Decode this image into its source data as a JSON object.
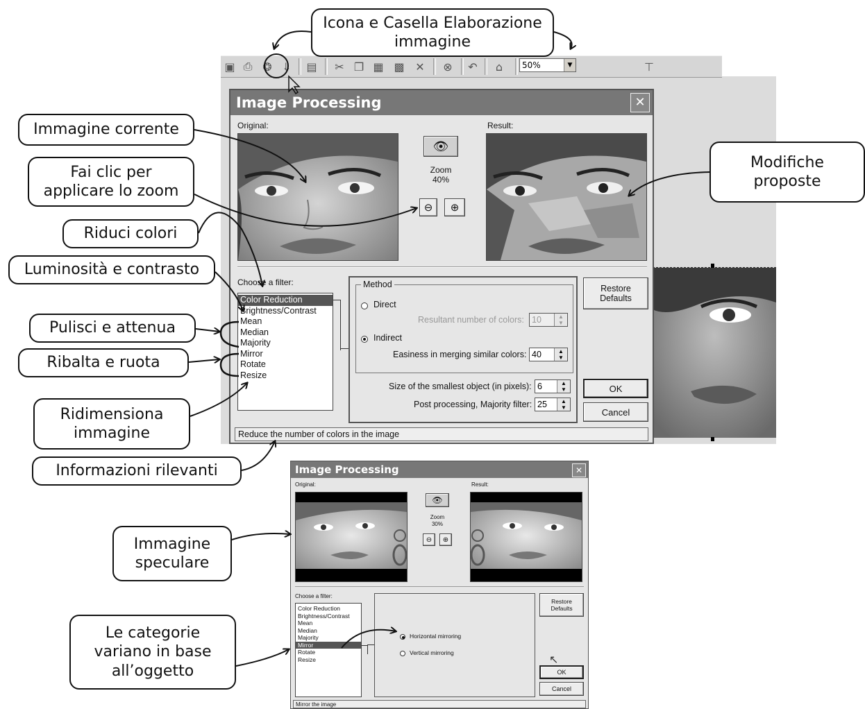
{
  "callouts": {
    "icona": [
      "Icona e Casella Elaborazione",
      "immagine"
    ],
    "immagine_corrente": "Immagine corrente",
    "fai_clic": [
      "Fai clic per",
      "applicare lo zoom"
    ],
    "modifiche": [
      "Modifiche",
      "proposte"
    ],
    "riduci": "Riduci colori",
    "luminosita": "Luminosità e contrasto",
    "pulisci": "Pulisci e attenua",
    "ribalta": "Ribalta e ruota",
    "ridimensiona": [
      "Ridimensiona",
      "immagine"
    ],
    "informazioni": "Informazioni rilevanti",
    "speculare": [
      "Immagine",
      "speculare"
    ],
    "categorie": [
      "Le categorie",
      "variano in base",
      "all’oggetto"
    ]
  },
  "toolbar": {
    "zoom_value": "50%"
  },
  "dialog_main": {
    "title": "Image Processing",
    "close": "✕",
    "original_label": "Original:",
    "result_label": "Result:",
    "zoom_label": "Zoom",
    "zoom_value": "40%",
    "filter_label": "Choose a filter:",
    "filters": [
      "Color Reduction",
      "Brightness/Contrast",
      "Mean",
      "Median",
      "Majority",
      "Mirror",
      "Rotate",
      "Resize"
    ],
    "selected_filter": "Color Reduction",
    "method_label": "Method",
    "direct_label": "Direct",
    "resultant_label": "Resultant number of colors:",
    "resultant_value": "10",
    "indirect_label": "Indirect",
    "easiness_label": "Easiness in merging similar colors:",
    "easiness_value": "40",
    "smallest_label": "Size of the smallest object (in pixels):",
    "smallest_value": "6",
    "post_label": "Post processing, Majority filter:",
    "post_value": "25",
    "restore_line1": "Restore",
    "restore_line2": "Defaults",
    "ok": "OK",
    "cancel": "Cancel",
    "status": "Reduce the number of colors in the image"
  },
  "dialog_small": {
    "title": "Image Processing",
    "close": "✕",
    "original_label": "Original:",
    "result_label": "Result:",
    "zoom_label": "Zoom",
    "zoom_value": "30%",
    "filter_label": "Choose a filter:",
    "filters": [
      "Color Reduction",
      "Brightness/Contrast",
      "Mean",
      "Median",
      "Majority",
      "Mirror",
      "Rotate",
      "Resize"
    ],
    "selected_filter": "Mirror",
    "horizontal": "Horizontal mirroring",
    "vertical": "Vertical mirroring",
    "restore_line1": "Restore",
    "restore_line2": "Defaults",
    "ok": "OK",
    "cancel": "Cancel",
    "status": "Mirror the image"
  },
  "colors": {
    "title_bar": "#777777",
    "dialog_bg": "#e6e6e6",
    "selection": "#555555"
  }
}
